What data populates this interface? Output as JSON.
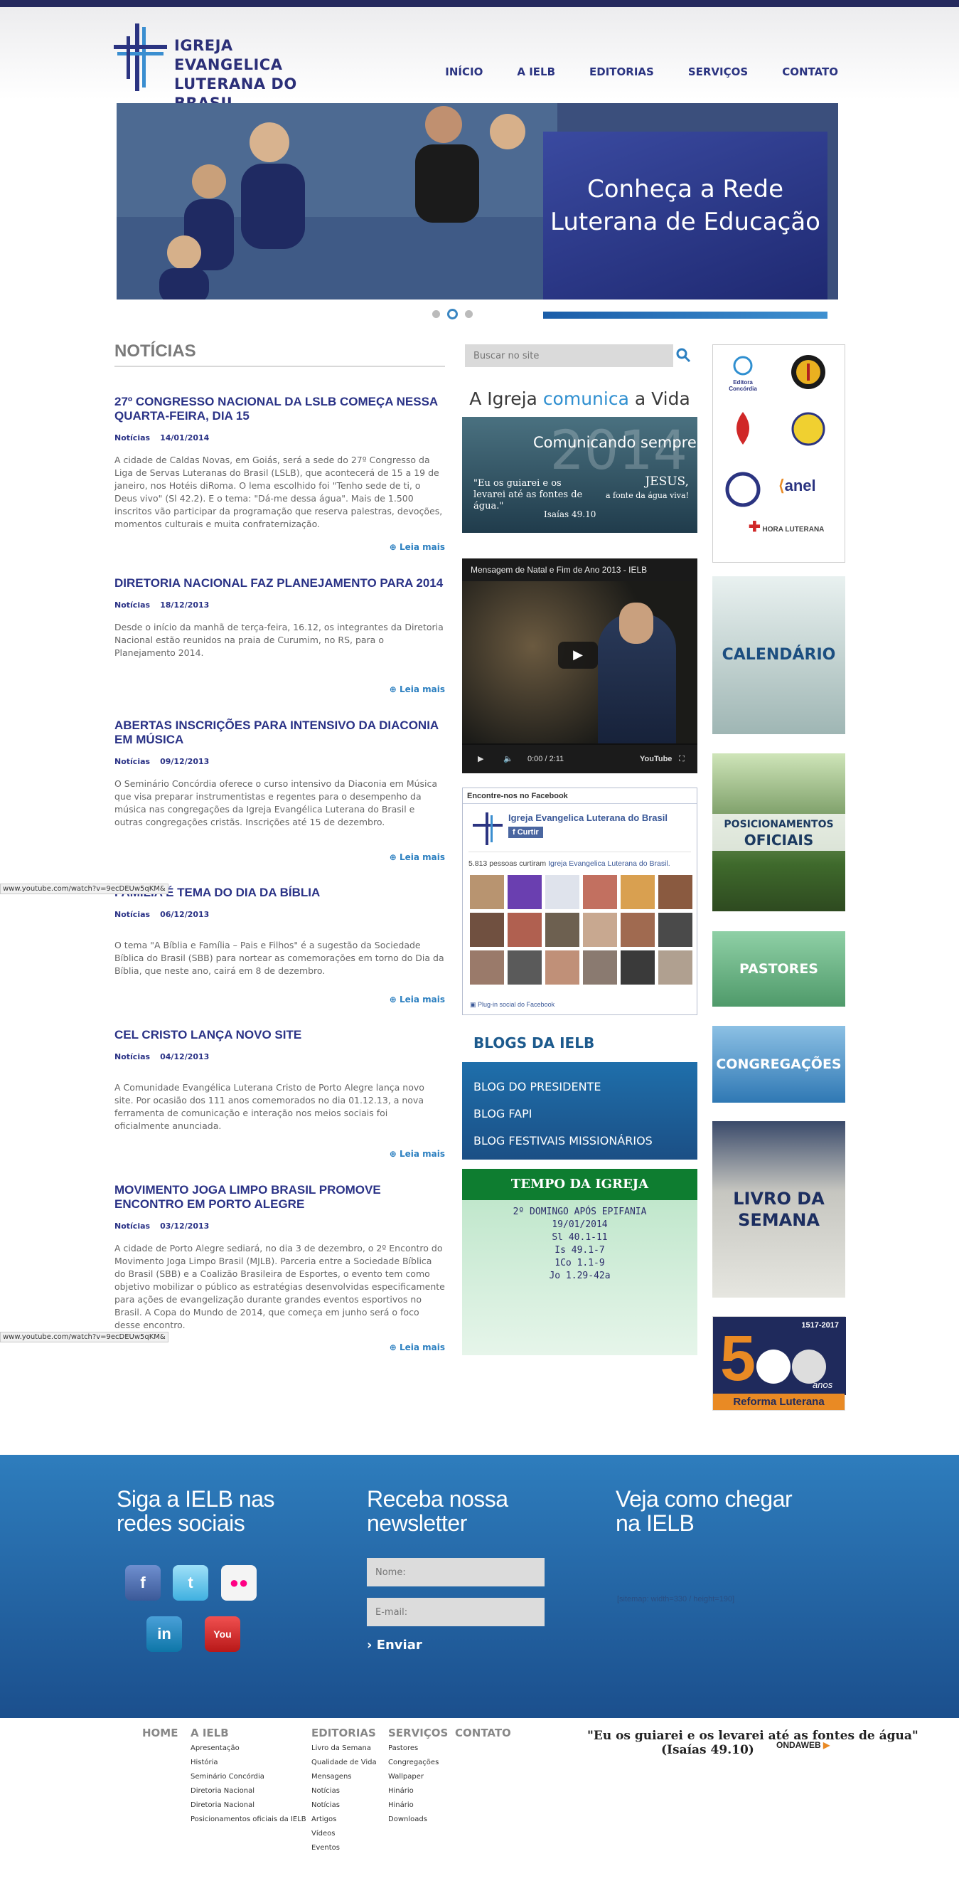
{
  "header": {
    "logo_text_1": "IGREJA EVANGELICA",
    "logo_text_2": "LUTERANA DO BRASIL",
    "nav": [
      "INÍCIO",
      "A IELB",
      "EDITORIAS",
      "SERVIÇOS",
      "CONTATO"
    ]
  },
  "hero": {
    "caption": "Conheça a Rede Luterana de Educação",
    "slides": 3,
    "active_slide": 2
  },
  "news_section": {
    "title": "NOTÍCIAS",
    "read_more": "Leia mais",
    "items": [
      {
        "title": "27º CONGRESSO NACIONAL DA LSLB COMEÇA NESSA QUARTA-FEIRA, DIA 15",
        "category": "Notícias",
        "date": "14/01/2014",
        "text": "A cidade de Caldas Novas, em Goiás, será a sede do 27º Congresso da Liga de Servas Luteranas do Brasil (LSLB), que acontecerá de 15 a 19 de janeiro, nos Hotéis diRoma. O lema escolhido foi \"Tenho sede de ti, o Deus vivo\" (Sl 42.2). E o tema: \"Dá-me dessa água\". Mais de 1.500 inscritos vão participar da programação que reserva palestras, devoções, momentos culturais e muita confraternização."
      },
      {
        "title": "DIRETORIA NACIONAL FAZ PLANEJAMENTO PARA 2014",
        "category": "Notícias",
        "date": "18/12/2013",
        "text": "Desde o início da manhã de terça-feira, 16.12, os integrantes da Diretoria Nacional estão reunidos na praia de Curumim, no RS, para o Planejamento 2014."
      },
      {
        "title": "ABERTAS INSCRIÇÕES PARA INTENSIVO DA DIACONIA EM MÚSICA",
        "category": "Notícias",
        "date": "09/12/2013",
        "text": "O Seminário Concórdia oferece o curso intensivo da Diaconia em Música que visa preparar instrumentistas e regentes para o desempenho da música nas congregações da Igreja Evangélica Luterana do Brasil e outras congregações cristãs. Inscrições até 15 de dezembro."
      },
      {
        "title": "FAMÍLIA É TEMA DO DIA DA BÍBLIA",
        "category": "Notícias",
        "date": "06/12/2013",
        "text": "O tema \"A Bíblia e Família – Pais e Filhos\" é a sugestão da Sociedade Bíblica do Brasil (SBB) para nortear as comemorações em torno do Dia da Bíblia, que neste ano, cairá em 8 de dezembro."
      },
      {
        "title": "CEL CRISTO LANÇA NOVO SITE",
        "category": "Notícias",
        "date": "04/12/2013",
        "text": "A Comunidade Evangélica Luterana Cristo de Porto Alegre lança novo site. Por ocasião dos 111 anos comemorados no dia 01.12.13, a nova ferramenta de comunicação e interação nos meios sociais foi oficialmente anunciada."
      },
      {
        "title": "MOVIMENTO JOGA LIMPO BRASIL PROMOVE ENCONTRO EM PORTO ALEGRE",
        "category": "Notícias",
        "date": "03/12/2013",
        "text": "A cidade de Porto Alegre sediará, no dia 3 de dezembro, o 2º Encontro do Movimento Joga Limpo Brasil (MJLB). Parceria entre a Sociedade Bíblica do Brasil (SBB) e a Coalizão Brasileira de Esportes, o evento tem como objetivo mobilizar o público as estratégias desenvolvidas especificamente para ações de evangelização durante grandes eventos esportivos no Brasil. A Copa do Mundo de 2014, que começa em junho será o foco desse encontro."
      }
    ]
  },
  "tooltip": "www.youtube.com/watch?v=9ecDEUw5qKM&",
  "search": {
    "placeholder": "Buscar no site"
  },
  "campaign": {
    "pre": "A Igreja ",
    "mid": "comunica",
    "post": " a Vida",
    "year": "2014",
    "slogan": "Comunicando sempre",
    "quote": "\"Eu os guiarei e os levarei até as fontes de água.\"",
    "jesus": "JESUS,",
    "jesus_sub": "a fonte da água viva!",
    "ref": "Isaías 49.10"
  },
  "video": {
    "title": "Mensagem de Natal e Fim de Ano 2013 - IELB",
    "time": "0:00 / 2:11",
    "logo": "YouTube"
  },
  "facebook": {
    "header": "Encontre-nos no Facebook",
    "page_name": "Igreja Evangelica Luterana do Brasil",
    "like": "Curtir",
    "count_pre": "5.813 pessoas curtiram ",
    "count_link": "Igreja Evangelica Luterana do Brasil.",
    "footer": "Plug-in social do Facebook"
  },
  "blogs": {
    "title": "BLOGS DA IELB",
    "items": [
      "BLOG DO PRESIDENTE",
      "BLOG FAPI",
      "BLOG FESTIVAIS MISSIONÁRIOS"
    ]
  },
  "tempo": {
    "title": "TEMPO DA IGREJA",
    "lines": [
      "2º DOMINGO APÓS EPIFANIA",
      "19/01/2014",
      "Sl 40.1-11",
      "Is 49.1-7",
      "1Co 1.1-9",
      "Jo 1.29-42a"
    ]
  },
  "partners": {
    "concordia": "Editora Concórdia",
    "anel": "anel",
    "hora": "HORA LUTERANA"
  },
  "tiles": {
    "calendario": "CALENDÁRIO",
    "posicionamentos_1": "POSICIONAMENTOS",
    "posicionamentos_2": "OFICIAIS",
    "pastores": "PASTORES",
    "congregacoes": "CONGREGAÇÕES",
    "livro": "LIVRO DA SEMANA",
    "reforma_years": "1517-2017",
    "reforma_num": "5",
    "reforma_anos": "anos",
    "reforma": "Reforma Luterana"
  },
  "footer": {
    "social_title": "Siga a IELB nas redes sociais",
    "newsletter_title": "Receba nossa newsletter",
    "name_placeholder": "Nome:",
    "email_placeholder": "E-mail:",
    "send": "Enviar",
    "map_title": "Veja como chegar na IELB",
    "map_broken": "[sitemap: width=330 / height=190]",
    "nav": {
      "home": "HOME",
      "ielb": "A IELB",
      "editorias": "EDITORIAS",
      "servicos": "SERVIÇOS",
      "contato": "CONTATO"
    },
    "ielb_links": [
      "Apresentação",
      "História",
      "Seminário Concórdia",
      "Diretoria Nacional",
      "Diretoria Nacional",
      "Posicionamentos oficiais da IELB"
    ],
    "editorias_links": [
      "Livro da Semana",
      "Qualidade de Vida",
      "Mensagens",
      "Notícias",
      "Notícias",
      "Artigos",
      "Vídeos",
      "Eventos"
    ],
    "servicos_links": [
      "Pastores",
      "Congregações",
      "Wallpaper",
      "Hinário",
      "Hinário",
      "Downloads"
    ],
    "quote": "\"Eu os guiarei e os levarei até as fontes de água\"",
    "quote_ref": "(Isaías 49.10)",
    "agency": "ONDAWEB"
  },
  "colors": {
    "brand": "#2b3481",
    "accent": "#2b7fc0",
    "footer": "#1f6fab"
  }
}
